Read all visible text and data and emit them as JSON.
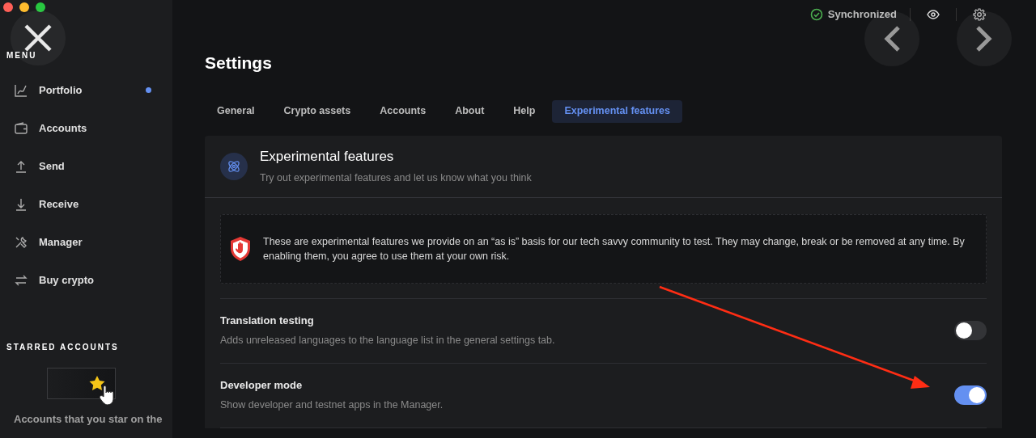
{
  "sidebar": {
    "menu_label": "MENU",
    "items": [
      {
        "label": "Portfolio",
        "notification": true
      },
      {
        "label": "Accounts",
        "notification": false
      },
      {
        "label": "Send",
        "notification": false
      },
      {
        "label": "Receive",
        "notification": false
      },
      {
        "label": "Manager",
        "notification": false
      },
      {
        "label": "Buy crypto",
        "notification": false
      }
    ],
    "starred_label": "STARRED ACCOUNTS",
    "starred_hint": "Accounts that you star on the"
  },
  "topbar": {
    "sync_status": "Synchronized"
  },
  "page_title": "Settings",
  "tabs": [
    {
      "label": "General",
      "selected": false
    },
    {
      "label": "Crypto assets",
      "selected": false
    },
    {
      "label": "Accounts",
      "selected": false
    },
    {
      "label": "About",
      "selected": false
    },
    {
      "label": "Help",
      "selected": false
    },
    {
      "label": "Experimental features",
      "selected": true
    }
  ],
  "section": {
    "title": "Experimental features",
    "subtitle": "Try out experimental features and let us know what you think",
    "notice": "These are experimental features we provide on an “as is” basis for our tech savvy community to test. They may change, break or be removed at any time. By enabling them, you agree to use them at your own risk.",
    "settings": [
      {
        "title": "Translation testing",
        "description": "Adds unreleased languages to the language list in the general settings tab.",
        "on": false
      },
      {
        "title": "Developer mode",
        "description": "Show developer and testnet apps in the Manager.",
        "on": true
      }
    ]
  }
}
